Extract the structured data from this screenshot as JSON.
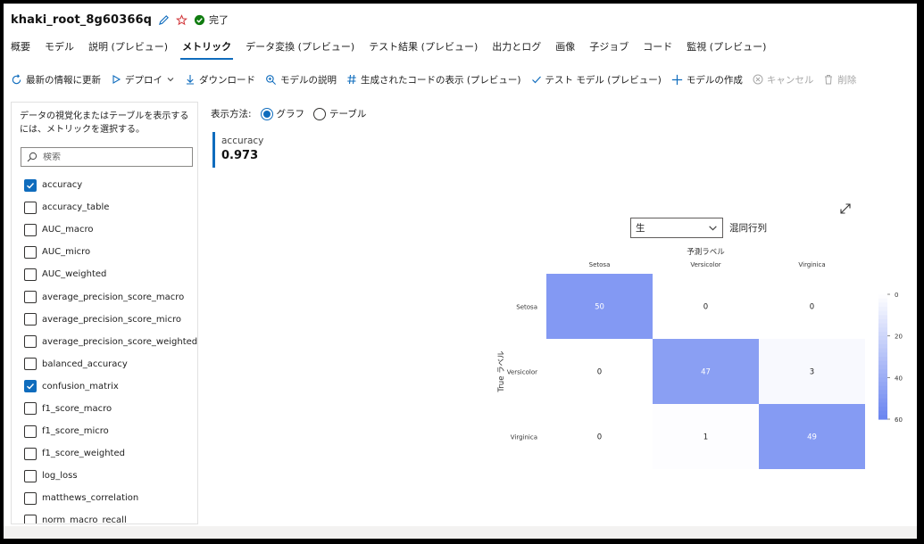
{
  "header": {
    "title": "khaki_root_8g60366q",
    "status": "完了"
  },
  "tabs": [
    {
      "label": "概要"
    },
    {
      "label": "モデル"
    },
    {
      "label": "説明 (プレビュー)"
    },
    {
      "label": "メトリック",
      "active": true
    },
    {
      "label": "データ変換 (プレビュー)"
    },
    {
      "label": "テスト結果 (プレビュー)"
    },
    {
      "label": "出力とログ"
    },
    {
      "label": "画像"
    },
    {
      "label": "子ジョブ"
    },
    {
      "label": "コード"
    },
    {
      "label": "監視 (プレビュー)"
    }
  ],
  "toolbar": {
    "refresh": "最新の情報に更新",
    "deploy": "デプロイ",
    "download": "ダウンロード",
    "explain": "モデルの説明",
    "show_code": "生成されたコードの表示 (プレビュー)",
    "test_model": "テスト モデル (プレビュー)",
    "create_model": "モデルの作成",
    "cancel": "キャンセル",
    "delete": "削除"
  },
  "left_panel": {
    "instruction": "データの視覚化またはテーブルを表示するには、メトリックを選択する。",
    "search_placeholder": "検索",
    "metrics": [
      {
        "label": "accuracy",
        "checked": true
      },
      {
        "label": "accuracy_table",
        "checked": false
      },
      {
        "label": "AUC_macro",
        "checked": false
      },
      {
        "label": "AUC_micro",
        "checked": false
      },
      {
        "label": "AUC_weighted",
        "checked": false
      },
      {
        "label": "average_precision_score_macro",
        "checked": false
      },
      {
        "label": "average_precision_score_micro",
        "checked": false
      },
      {
        "label": "average_precision_score_weighted",
        "checked": false
      },
      {
        "label": "balanced_accuracy",
        "checked": false
      },
      {
        "label": "confusion_matrix",
        "checked": true
      },
      {
        "label": "f1_score_macro",
        "checked": false
      },
      {
        "label": "f1_score_micro",
        "checked": false
      },
      {
        "label": "f1_score_weighted",
        "checked": false
      },
      {
        "label": "log_loss",
        "checked": false
      },
      {
        "label": "matthews_correlation",
        "checked": false
      },
      {
        "label": "norm_macro_recall",
        "checked": false
      }
    ]
  },
  "display_mode": {
    "label": "表示方法:",
    "graph": "グラフ",
    "table": "テーブル",
    "selected": "graph"
  },
  "accuracy_card": {
    "label": "accuracy",
    "value": "0.973"
  },
  "confusion_view": {
    "select_value": "生",
    "title": "混同行列"
  },
  "colors": {
    "accent": "#0f6cbd",
    "cell_high": "#6a84f0",
    "cell_low": "#dfe3f9"
  },
  "chart_data": {
    "type": "heatmap",
    "xlabel": "予測ラベル",
    "ylabel": "True ラベル",
    "x_categories": [
      "Setosa",
      "Versicolor",
      "Virginica"
    ],
    "y_categories": [
      "Setosa",
      "Versicolor",
      "Virginica"
    ],
    "values": [
      [
        50,
        0,
        0
      ],
      [
        0,
        47,
        3
      ],
      [
        0,
        1,
        49
      ]
    ],
    "colorbar": {
      "min": 0,
      "max": 60,
      "ticks": [
        0,
        20,
        40,
        60
      ]
    }
  }
}
